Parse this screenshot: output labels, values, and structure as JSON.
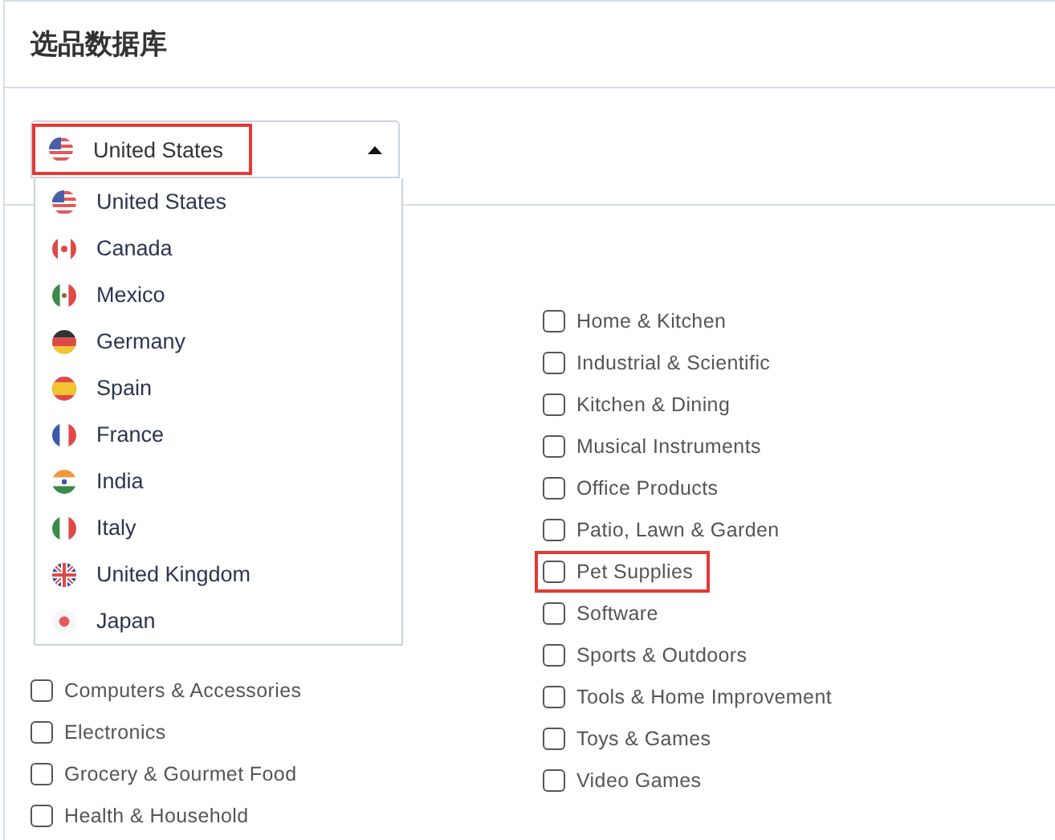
{
  "title": "选品数据库",
  "country_select": {
    "value": "United States",
    "highlighted": true,
    "expanded": true
  },
  "country_options": [
    {
      "label": "United States"
    },
    {
      "label": "Canada"
    },
    {
      "label": "Mexico"
    },
    {
      "label": "Germany"
    },
    {
      "label": "Spain"
    },
    {
      "label": "France"
    },
    {
      "label": "India"
    },
    {
      "label": "Italy"
    },
    {
      "label": "United Kingdom"
    },
    {
      "label": "Japan"
    }
  ],
  "categories_left": [
    {
      "label": "Computers & Accessories",
      "checked": false
    },
    {
      "label": "Electronics",
      "checked": false
    },
    {
      "label": "Grocery & Gourmet Food",
      "checked": false
    },
    {
      "label": "Health & Household",
      "checked": false
    }
  ],
  "categories_right": [
    {
      "label": "Home & Kitchen",
      "checked": false
    },
    {
      "label": "Industrial & Scientific",
      "checked": false
    },
    {
      "label": "Kitchen & Dining",
      "checked": false
    },
    {
      "label": "Musical Instruments",
      "checked": false
    },
    {
      "label": "Office Products",
      "checked": false
    },
    {
      "label": "Patio, Lawn & Garden",
      "checked": false
    },
    {
      "label": "Pet Supplies",
      "checked": false,
      "highlighted": true
    },
    {
      "label": "Software",
      "checked": false
    },
    {
      "label": "Sports & Outdoors",
      "checked": false
    },
    {
      "label": "Tools & Home Improvement",
      "checked": false
    },
    {
      "label": "Toys & Games",
      "checked": false
    },
    {
      "label": "Video Games",
      "checked": false
    }
  ]
}
